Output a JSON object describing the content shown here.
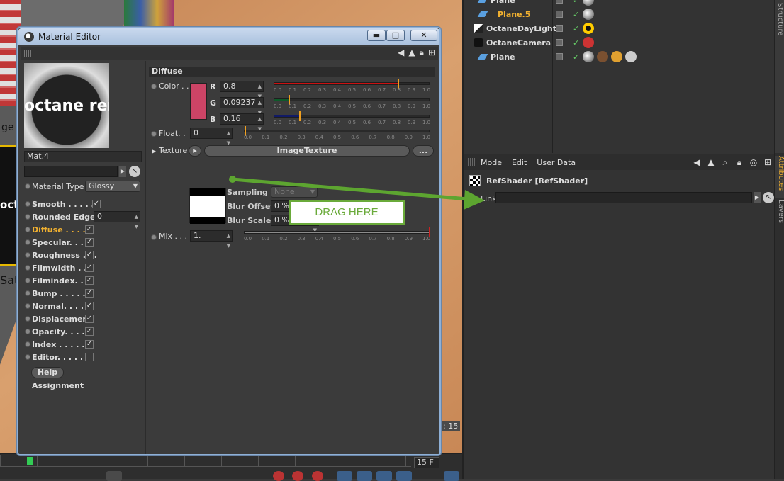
{
  "viewport": {
    "text_ge": "ge",
    "text_octa": "octa",
    "text_sat": "Sat",
    "time_readout": ": 15",
    "frame_readout": "15 F"
  },
  "object_manager": {
    "side_tab": "Structure",
    "objects": [
      {
        "name": "Plane",
        "highlight": false,
        "icon": "plane-icon"
      },
      {
        "name": "Plane.5",
        "highlight": true,
        "icon": "plane-icon"
      },
      {
        "name": "OctaneDayLight",
        "highlight": false,
        "icon": "light-icon"
      },
      {
        "name": "OctaneCamera",
        "highlight": false,
        "icon": "camera-icon"
      },
      {
        "name": "Plane",
        "highlight": false,
        "icon": "plane-icon"
      }
    ]
  },
  "attribute_manager": {
    "menus": [
      "Mode",
      "Edit",
      "User Data"
    ],
    "title": "RefShader [RefShader]",
    "link_label": "Link",
    "side_tabs": [
      "Attributes",
      "Layers"
    ]
  },
  "material_editor": {
    "window_title": "Material Editor",
    "window_buttons": {
      "minimize": "▬",
      "maximize": "□",
      "close": "✕"
    },
    "preview_text": "octane rend",
    "material_name": "Mat.4",
    "material_type_label": "Material Type",
    "material_type_value": "Glossy",
    "properties": [
      {
        "label": "Smooth . . . . . .",
        "checked": true,
        "active": false
      },
      {
        "label": "Rounded Edges",
        "checked": false,
        "active": false,
        "value": "0"
      },
      {
        "label": "Diffuse . . . . .",
        "checked": true,
        "active": true
      },
      {
        "label": "Specular. . . . .",
        "checked": true,
        "active": false
      },
      {
        "label": "Roughness . . .",
        "checked": true,
        "active": false
      },
      {
        "label": "Filmwidth . .",
        "checked": true,
        "active": false
      },
      {
        "label": "Filmindex. . . .",
        "checked": true,
        "active": false
      },
      {
        "label": "Bump . . . . . .",
        "checked": true,
        "active": false
      },
      {
        "label": "Normal. . . . .",
        "checked": true,
        "active": false
      },
      {
        "label": "Displacement",
        "checked": true,
        "active": false
      },
      {
        "label": "Opacity. . . . .",
        "checked": true,
        "active": false
      },
      {
        "label": "Index . . . . . .",
        "checked": true,
        "active": false
      },
      {
        "label": "Editor. . . . . .",
        "checked": false,
        "active": false
      }
    ],
    "help_button": "Help",
    "assignment_label": "Assignment",
    "diffuse": {
      "section_title": "Diffuse",
      "color_label": "Color",
      "color_dots": ". .",
      "swatch_color": "#cc4466",
      "channels": [
        {
          "label": "R",
          "value": "0.8",
          "fraction": 0.8,
          "fill": "#cc1111"
        },
        {
          "label": "G",
          "value": "0.09237",
          "fraction": 0.09237,
          "fill": "#0f5a2a"
        },
        {
          "label": "B",
          "value": "0.16",
          "fraction": 0.16,
          "fill": "#111a66"
        }
      ],
      "ticks": [
        "0.0",
        "0.1",
        "0.2",
        "0.3",
        "0.4",
        "0.5",
        "0.6",
        "0.7",
        "0.8",
        "0.9",
        "1.0"
      ],
      "float_label": "Float. .",
      "float_value": "0",
      "float_fraction": 0.0,
      "texture_label": "Texture",
      "texture_button": "ImageTexture",
      "texture_more": "...",
      "sampling_label": "Sampling",
      "sampling_value": "None",
      "blur_offset_label": "Blur Offset",
      "blur_offset_value": "0 %",
      "blur_scale_label": "Blur Scale",
      "blur_scale_value": "0 %",
      "mix_label": "Mix . . .",
      "mix_value": "1.",
      "mix_fraction": 1.0
    }
  },
  "annotation": {
    "drag_text": "DRAG HERE",
    "arrow_color": "#5da530"
  }
}
